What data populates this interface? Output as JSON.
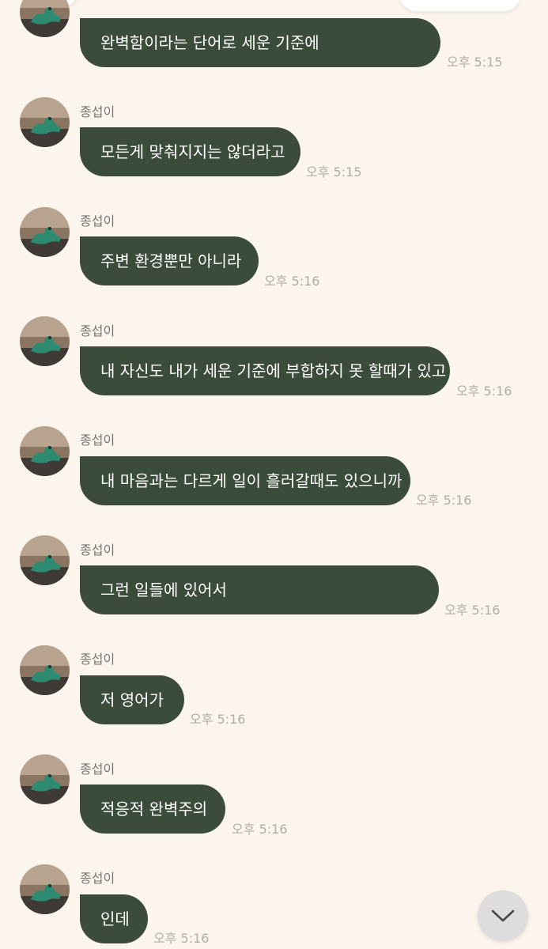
{
  "messages": [
    {
      "sender": "",
      "text": "완벽함이라는 단어로 세운 기준에",
      "time": "오후 5:15"
    },
    {
      "sender": "종섭이",
      "text": "모든게 맞춰지지는 않더라고",
      "time": "오후 5:15"
    },
    {
      "sender": "종섭이",
      "text": "주변 환경뿐만 아니라",
      "time": "오후 5:16"
    },
    {
      "sender": "종섭이",
      "text": "내 자신도 내가 세운 기준에 부합하지 못 할때가 있고",
      "time": "오후 5:16"
    },
    {
      "sender": "종섭이",
      "text": "내 마음과는 다르게 일이 흘러갈때도 있으니까",
      "time": "오후 5:16"
    },
    {
      "sender": "종섭이",
      "text": "그런 일들에 있어서",
      "time": "오후 5:16"
    },
    {
      "sender": "종섭이",
      "text": "저 영어가",
      "time": "오후 5:16"
    },
    {
      "sender": "종섭이",
      "text": "적응적 완벽주의",
      "time": "오후 5:16"
    },
    {
      "sender": "종섭이",
      "text": "인데",
      "time": "오후 5:16"
    }
  ],
  "icons": {
    "scroll_down": "chevron-down-icon",
    "avatar": "avatar-dinosaur-figure"
  },
  "colors": {
    "background": "#fcf5ee",
    "bubble": "#3b4d3a",
    "bubble_text": "#ffffff",
    "time_text": "#b3aca6",
    "sender_text": "#7a7470"
  }
}
